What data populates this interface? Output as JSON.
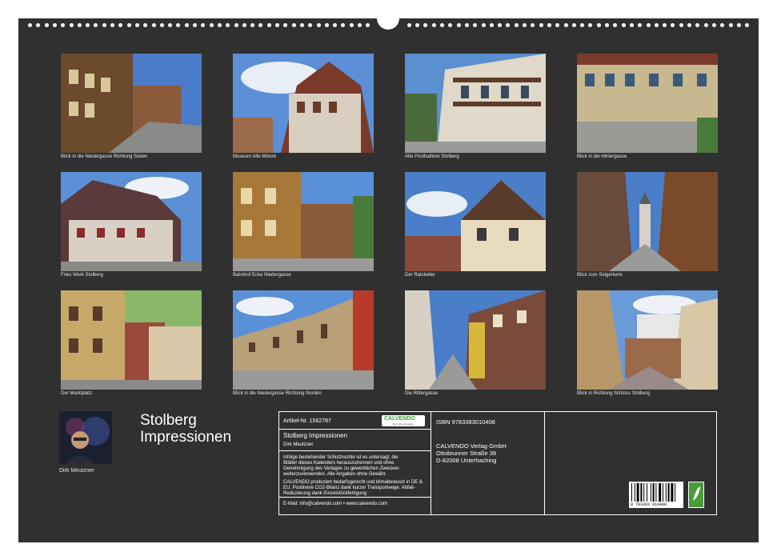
{
  "photos": [
    {
      "caption": "Blick in die Niedergasse Richtung Süden"
    },
    {
      "caption": "Museum Alte Münze"
    },
    {
      "caption": "Alte Posthalterei Stolberg"
    },
    {
      "caption": "Blick in die Hintergasse"
    },
    {
      "caption": "Fries Werk Stolberg"
    },
    {
      "caption": "Bahnhof Ecke Niedergasse"
    },
    {
      "caption": "Der Ratskeller"
    },
    {
      "caption": "Blick zum Seigerturm"
    },
    {
      "caption": "Der Marktplatz"
    },
    {
      "caption": "Blick in die Niedergasse Richtung Norden"
    },
    {
      "caption": "Die Rittergasse"
    },
    {
      "caption": "Blick in Richtung Schloss Stolberg"
    }
  ],
  "title_line1": "Stolberg",
  "title_line2": "Impressionen",
  "author": "Dirk Meutzner",
  "info": {
    "article_no": "Artikel-Nr. 1562787",
    "logo": "CALVENDO",
    "logo_tagline": "Die Kalenderverlag",
    "product_title": "Stolberg Impressionen",
    "product_author": "Dirk Meutzner",
    "legal_1": "Infolge bestehender Schutzrechte ist es untersagt, die",
    "legal_2": "Blätter dieses Kalenders herauszutrennen und ohne",
    "legal_3": "Genehmigung des Verlages zu gewerblichen Zwecken",
    "legal_4": "weiterzuverwenden. Alle Angaben ohne Gewähr.",
    "eco_1": "CALVENDO produziert bedarfsgerecht und klimabewusst in DE &",
    "eco_2": "EU. Positivere CO2-Bilanz dank kurzer Transportwege. Abfall-",
    "eco_3": "Reduzierung dank Einzelstückfertigung",
    "contact": "E-Mail: info@calvendo.com • www.calvendo.com",
    "isbn": "ISBN 9783383010408",
    "publisher_1": "CALVENDO Verlag GmbH",
    "publisher_2": "Ottobrunner Straße 39",
    "publisher_3": "D-82008 Unterhaching",
    "barcode_digits": "9 783383 010408"
  }
}
